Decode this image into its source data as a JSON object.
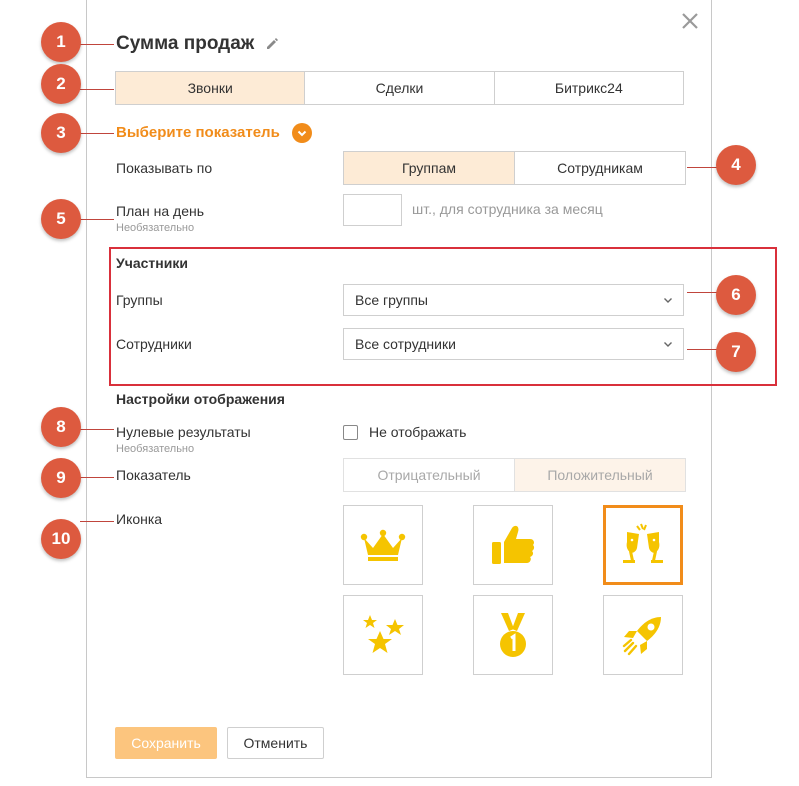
{
  "header": {
    "title": "Сумма продаж"
  },
  "source_tabs": [
    {
      "label": "Звонки",
      "active": true
    },
    {
      "label": "Сделки",
      "active": false
    },
    {
      "label": "Битрикс24",
      "active": false
    }
  ],
  "metric": {
    "label": "Выберите показатель"
  },
  "show_by": {
    "label": "Показывать по",
    "options": [
      {
        "label": "Группам",
        "active": true
      },
      {
        "label": "Сотрудникам",
        "active": false
      }
    ]
  },
  "plan": {
    "label": "План на день",
    "optional": "Необязательно",
    "value": "",
    "hint": "шт., для сотрудника за месяц"
  },
  "participants": {
    "title": "Участники",
    "groups_label": "Группы",
    "groups_value": "Все группы",
    "employees_label": "Сотрудники",
    "employees_value": "Все сотрудники"
  },
  "display": {
    "title": "Настройки отображения",
    "zero_label": "Нулевые результаты",
    "zero_optional": "Необязательно",
    "zero_checkbox_label": "Не отображать",
    "indicator_label": "Показатель",
    "indicator_options": [
      {
        "label": "Отрицательный",
        "active": false
      },
      {
        "label": "Положительный",
        "active": true
      }
    ],
    "icon_label": "Иконка",
    "icons": [
      "crown-icon",
      "thumbs-up-icon",
      "champagne-icon",
      "stars-icon",
      "medal-icon",
      "rocket-icon"
    ],
    "selected_icon": "champagne-icon"
  },
  "buttons": {
    "save": "Сохранить",
    "cancel": "Отменить"
  },
  "annotations": [
    "1",
    "2",
    "3",
    "4",
    "5",
    "6",
    "7",
    "8",
    "9",
    "10"
  ],
  "colors": {
    "accent": "#f18c1a",
    "icon_yellow": "#f5c400",
    "badge": "#dd5a3f",
    "highlight_border": "#d9303b",
    "active_tab_bg": "#fdebd6"
  }
}
